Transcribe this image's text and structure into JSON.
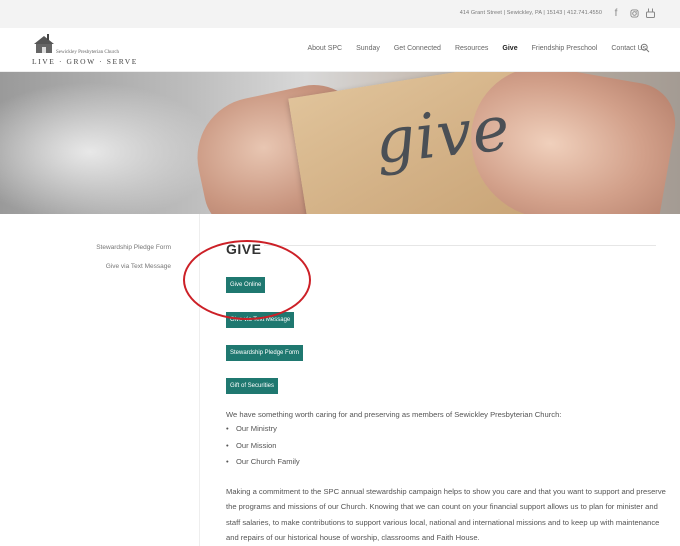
{
  "topbar": {
    "address": "414 Grant Street | Sewickley, PA | 15143 | 412.741.4550",
    "social": [
      {
        "icon": "facebook-icon",
        "glyph": "f"
      },
      {
        "icon": "instagram-icon",
        "glyph": "◎"
      },
      {
        "icon": "youtube-icon",
        "glyph": "▣"
      }
    ]
  },
  "logo": {
    "name": "Sewickley Presbyterian Church",
    "tagline": "LIVE · GROW · SERVE"
  },
  "nav": {
    "items": [
      "About SPC",
      "Sunday",
      "Get Connected",
      "Resources",
      "Give",
      "Friendship Preschool",
      "Contact Us"
    ],
    "active": "Give",
    "search_icon": "search-icon"
  },
  "hero": {
    "text": "give"
  },
  "sidebar": {
    "links": [
      "Stewardship Pledge Form",
      "Give via Text Message"
    ]
  },
  "main": {
    "title": "GIVE",
    "buttons": [
      "Give Online",
      "Give via Text Message",
      "Stewardship Pledge Form",
      "Gift of Securities"
    ],
    "intro": "We have something worth caring for and preserving as members of Sewickley Presbyterian Church:",
    "bullets": [
      "Our Ministry",
      "Our Mission",
      "Our Church Family"
    ],
    "paragraph": "Making a commitment to the SPC annual stewardship campaign helps to show you care and that you want to support and preserve the programs and missions of our Church. Knowing that we can count on your financial support allows us to plan for minister and staff salaries, to make contributions to support various local, national and international missions and to keep up with maintenance and repairs of our historical house of worship, classrooms and Faith House."
  },
  "colors": {
    "button": "#1f7870",
    "annotation": "#cc2027"
  }
}
